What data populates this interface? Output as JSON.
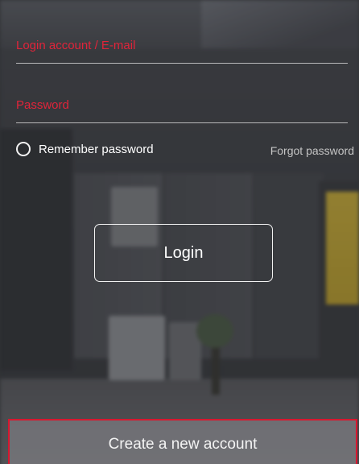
{
  "form": {
    "account": {
      "placeholder": "Login account / E-mail",
      "value": ""
    },
    "password": {
      "placeholder": "Password",
      "value": ""
    },
    "remember": {
      "label": "Remember password",
      "checked": false
    },
    "forgot_label": "Forgot password",
    "login_label": "Login",
    "create_account_label": "Create a new account"
  },
  "colors": {
    "placeholder": "#e0243a",
    "create_account_border": "#d7172f",
    "text": "#ffffff",
    "muted_text": "#c4c4c4"
  }
}
